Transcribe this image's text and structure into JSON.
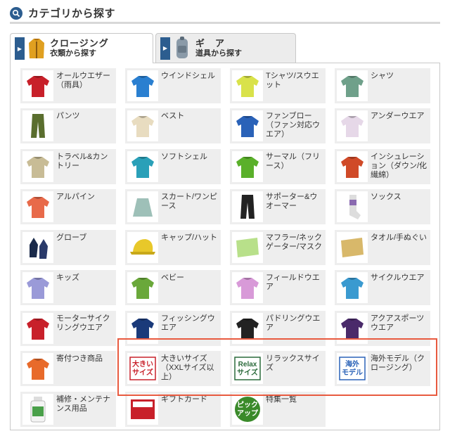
{
  "header": {
    "title": "カテゴリから探す",
    "icon": "search-icon"
  },
  "tabs": [
    {
      "main": "クロージング",
      "sub": "衣類から探す",
      "active": true,
      "icon": "jacket-icon"
    },
    {
      "main": "ギ　ア",
      "sub": "道具から探す",
      "active": false,
      "icon": "backpack-icon"
    }
  ],
  "categories": [
    {
      "label": "オールウエザー（雨具）",
      "icon": "rain-jacket-icon",
      "color": "#c8202a"
    },
    {
      "label": "ウインドシェル",
      "icon": "wind-shell-icon",
      "color": "#2a7fd0"
    },
    {
      "label": "Tシャツ/スウエット",
      "icon": "tshirt-icon",
      "color": "#d9e24a"
    },
    {
      "label": "シャツ",
      "icon": "shirt-icon",
      "color": "#6fa08a"
    },
    {
      "label": "パンツ",
      "icon": "pants-icon",
      "color": "#5a6e2e"
    },
    {
      "label": "ベスト",
      "icon": "vest-icon",
      "color": "#e8dcc0"
    },
    {
      "label": "ファンブロー（ファン対応ウエア）",
      "icon": "fan-vest-icon",
      "color": "#2a62b8"
    },
    {
      "label": "アンダーウエア",
      "icon": "underwear-icon",
      "color": "#e6d8e8"
    },
    {
      "label": "トラベル&カントリー",
      "icon": "travel-shirt-icon",
      "color": "#c8bc96"
    },
    {
      "label": "ソフトシェル",
      "icon": "soft-shell-icon",
      "color": "#2aa0b8"
    },
    {
      "label": "サーマル（フリース）",
      "icon": "fleece-icon",
      "color": "#5ab02a"
    },
    {
      "label": "インシュレーション（ダウン/化繊綿）",
      "icon": "down-jacket-icon",
      "color": "#d04a28"
    },
    {
      "label": "アルパイン",
      "icon": "alpine-jacket-icon",
      "color": "#e86a4a"
    },
    {
      "label": "スカート/ワンピース",
      "icon": "skirt-icon",
      "color": "#9ec0b8"
    },
    {
      "label": "サポーター&ウオーマー",
      "icon": "tights-icon",
      "color": "#222222"
    },
    {
      "label": "ソックス",
      "icon": "socks-icon",
      "color": "#8a6ab0"
    },
    {
      "label": "グローブ",
      "icon": "gloves-icon",
      "color": "#1a2a4a"
    },
    {
      "label": "キャップ/ハット",
      "icon": "cap-icon",
      "color": "#e8c82a"
    },
    {
      "label": "マフラー/ネックゲーター/マスク",
      "icon": "neck-gaiter-icon",
      "color": "#b8e08a"
    },
    {
      "label": "タオル/手ぬぐい",
      "icon": "towel-icon",
      "color": "#d8b86a"
    },
    {
      "label": "キッズ",
      "icon": "kids-jacket-icon",
      "color": "#9a9ad8"
    },
    {
      "label": "ベビー",
      "icon": "baby-tshirt-icon",
      "color": "#6aa83a"
    },
    {
      "label": "フィールドウエア",
      "icon": "field-jacket-icon",
      "color": "#d89ad8"
    },
    {
      "label": "サイクルウエア",
      "icon": "cycle-jersey-icon",
      "color": "#3a9ad0"
    },
    {
      "label": "モーターサイクリングウエア",
      "icon": "motorcycle-jacket-icon",
      "color": "#c8202a"
    },
    {
      "label": "フィッシングウエア",
      "icon": "fishing-jacket-icon",
      "color": "#1a3a7a"
    },
    {
      "label": "パドリングウエア",
      "icon": "paddling-jacket-icon",
      "color": "#222222"
    },
    {
      "label": "アクアスポーツウエア",
      "icon": "aqua-top-icon",
      "color": "#4a2a6a"
    },
    {
      "label": "寄付つき商品",
      "icon": "donation-tshirt-icon",
      "color": "#e86a2a"
    },
    {
      "label": "大きいサイズ（XXLサイズ以上）",
      "icon": "big-size-badge-icon",
      "color": "#c8202a",
      "badge": [
        "大きい",
        "サイズ"
      ]
    },
    {
      "label": "リラックスサイズ",
      "icon": "relax-size-badge-icon",
      "color": "#2a6a3a",
      "badge": [
        "Relax",
        "サイズ"
      ]
    },
    {
      "label": "海外モデル（クロージング）",
      "icon": "overseas-model-badge-icon",
      "color": "#2a62b8",
      "badge": [
        "海外",
        "モデル"
      ]
    },
    {
      "label": "補修・メンテナンス用品",
      "icon": "maintenance-bottle-icon",
      "color": "#4aa04a"
    },
    {
      "label": "ギフトカード",
      "icon": "gift-card-icon",
      "color": "#c8202a"
    },
    {
      "label": "特集一覧",
      "icon": "pickup-badge-icon",
      "color": "#3a8a2a",
      "badge": [
        "ピック",
        "アップ"
      ]
    }
  ]
}
